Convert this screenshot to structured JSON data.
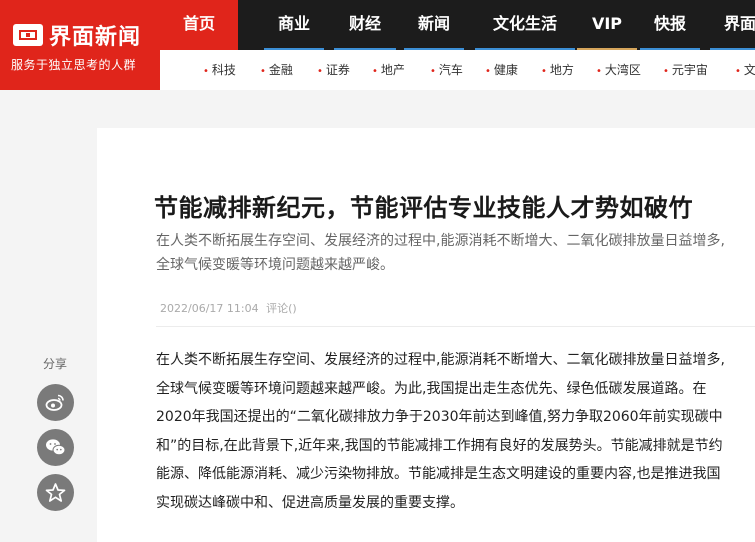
{
  "brand": {
    "name": "界面新闻",
    "slogan": "服务于独立思考的人群",
    "color": "#e0251b"
  },
  "nav": {
    "items": [
      {
        "label": "首页",
        "active": true
      },
      {
        "label": "商业"
      },
      {
        "label": "财经"
      },
      {
        "label": "新闻"
      },
      {
        "label": "文化生活"
      },
      {
        "label": "VIP"
      },
      {
        "label": "快报"
      },
      {
        "label": "界面"
      }
    ]
  },
  "subnav": {
    "items": [
      {
        "label": "科技"
      },
      {
        "label": "金融"
      },
      {
        "label": "证券"
      },
      {
        "label": "地产"
      },
      {
        "label": "汽车"
      },
      {
        "label": "健康"
      },
      {
        "label": "地方"
      },
      {
        "label": "大湾区"
      },
      {
        "label": "元宇宙"
      },
      {
        "label": "文"
      }
    ]
  },
  "article": {
    "title": "节能减排新纪元，节能评估专业技能人才势如破竹",
    "summary": "在人类不断拓展生存空间、发展经济的过程中,能源消耗不断增大、二氧化碳排放量日益增多,全球气候变暖等环境问题越来越严峻。",
    "date": "2022/06/17 11:04",
    "comments_label": "评论()",
    "body": "在人类不断拓展生存空间、发展经济的过程中,能源消耗不断增大、二氧化碳排放量日益增多,全球气候变暖等环境问题越来越严峻。为此,我国提出走生态优先、绿色低碳发展道路。在2020年我国还提出的“二氧化碳排放力争于2030年前达到峰值,努力争取2060年前实现碳中和”的目标,在此背景下,近年来,我国的节能减排工作拥有良好的发展势头。节能减排就是节约能源、降低能源消耗、减少污染物排放。节能减排是生态文明建设的重要内容,也是推进我国实现碳达峰碳中和、促进高质量发展的重要支撑。"
  },
  "share": {
    "label": "分享",
    "buttons": [
      {
        "icon": "weibo-icon"
      },
      {
        "icon": "wechat-icon"
      },
      {
        "icon": "star-icon"
      }
    ]
  }
}
